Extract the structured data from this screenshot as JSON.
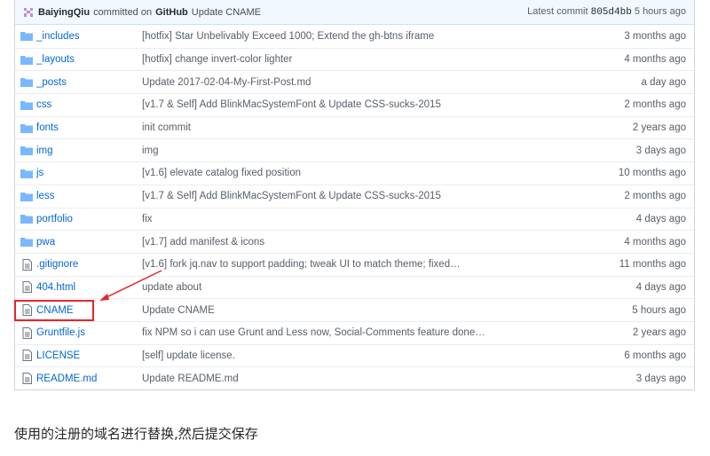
{
  "commit_bar": {
    "author": "BaiyingQiu",
    "committed_on": "committed on",
    "platform": "GitHub",
    "message": "Update CNAME",
    "latest_label": "Latest commit",
    "sha": "805d4bb",
    "time": "5 hours ago"
  },
  "files": [
    {
      "type": "folder",
      "name": "_includes",
      "message": "[hotfix] Star Unbelivably Exceed 1000; Extend the gh-btns iframe",
      "age": "3 months ago"
    },
    {
      "type": "folder",
      "name": "_layouts",
      "message": "[hotfix] change invert-color lighter",
      "age": "4 months ago"
    },
    {
      "type": "folder",
      "name": "_posts",
      "message": "Update 2017-02-04-My-First-Post.md",
      "age": "a day ago"
    },
    {
      "type": "folder",
      "name": "css",
      "message": "[v1.7 & Self] Add BlinkMacSystemFont & Update CSS-sucks-2015",
      "age": "2 months ago"
    },
    {
      "type": "folder",
      "name": "fonts",
      "message": "init commit",
      "age": "2 years ago"
    },
    {
      "type": "folder",
      "name": "img",
      "message": "img",
      "age": "3 days ago"
    },
    {
      "type": "folder",
      "name": "js",
      "message": "[v1.6] elevate catalog fixed position",
      "age": "10 months ago"
    },
    {
      "type": "folder",
      "name": "less",
      "message": "[v1.7 & Self] Add BlinkMacSystemFont & Update CSS-sucks-2015",
      "age": "2 months ago"
    },
    {
      "type": "folder",
      "name": "portfolio",
      "message": "fix",
      "age": "4 days ago"
    },
    {
      "type": "folder",
      "name": "pwa",
      "message": "[v1.7] add manifest & icons",
      "age": "4 months ago"
    },
    {
      "type": "file",
      "name": ".gitignore",
      "message": "[v1.6] fork jq.nav to support padding; tweak UI to match theme; fixed…",
      "age": "11 months ago"
    },
    {
      "type": "file",
      "name": "404.html",
      "message": "update about",
      "age": "4 days ago"
    },
    {
      "type": "file",
      "name": "CNAME",
      "message": "Update CNAME",
      "age": "5 hours ago"
    },
    {
      "type": "file",
      "name": "Gruntfile.js",
      "message": "fix NPM so i can use Grunt and Less now, Social-Comments feature done…",
      "age": "2 years ago"
    },
    {
      "type": "file",
      "name": "LICENSE",
      "message": "[self] update license.",
      "age": "6 months ago"
    },
    {
      "type": "file",
      "name": "README.md",
      "message": "Update README.md",
      "age": "3 days ago"
    }
  ],
  "caption": "使用的注册的域名进行替换,然后提交保存",
  "colors": {
    "highlight": "#e3262a",
    "link": "#0366d6",
    "folder": "#79b8ff"
  }
}
